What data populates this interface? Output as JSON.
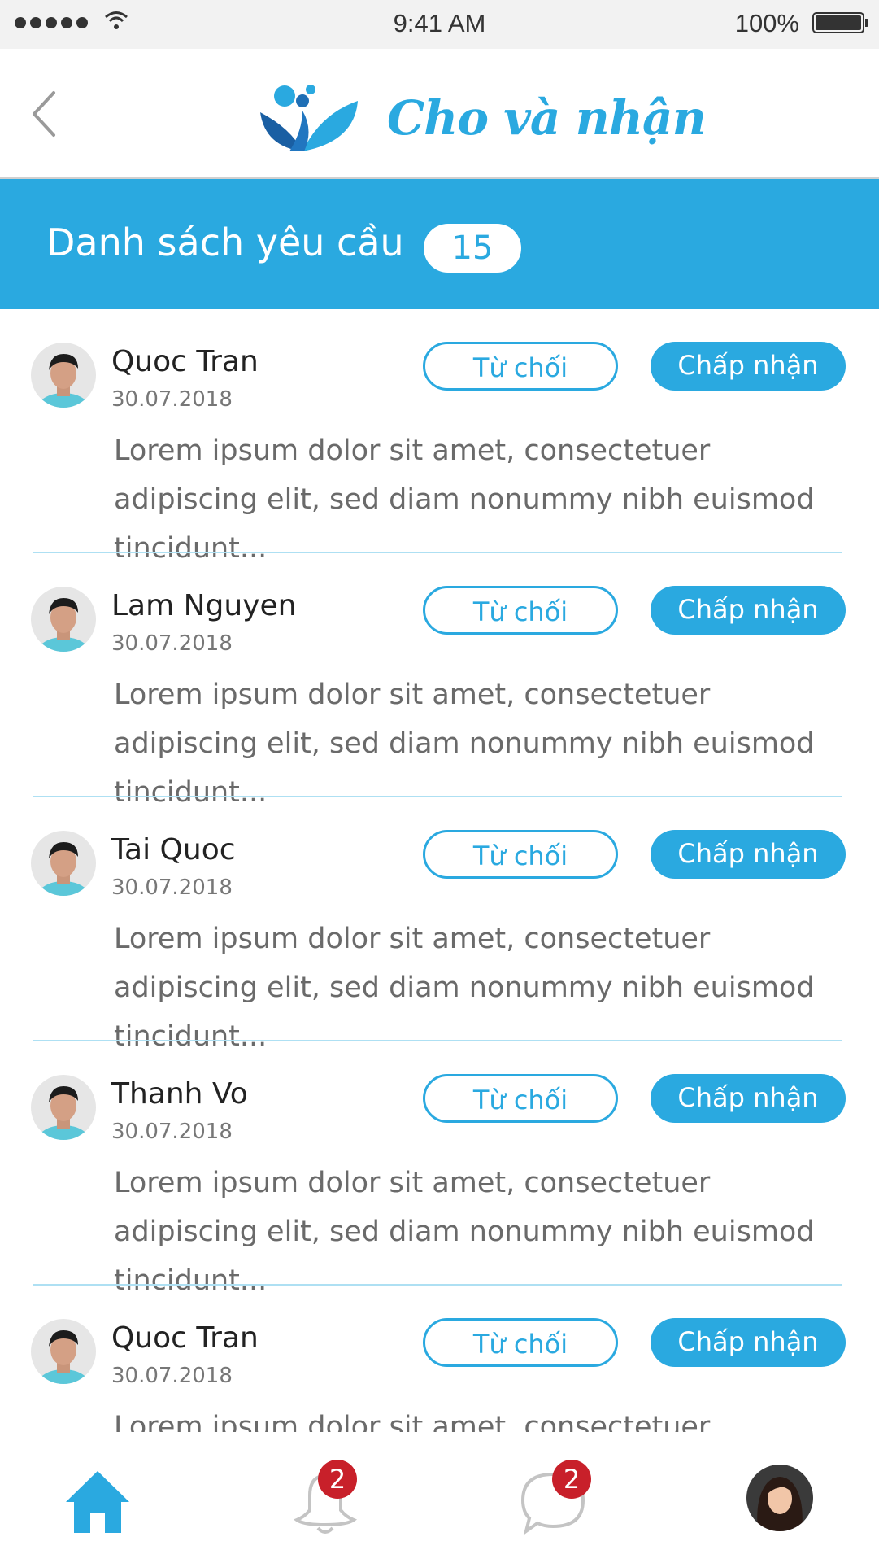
{
  "status_bar": {
    "time": "9:41 AM",
    "battery": "100%"
  },
  "nav": {
    "app_name": "Cho và nhận",
    "back_icon": "chevron-left-icon",
    "logo_icon": "leaf-logo-icon"
  },
  "header": {
    "title": "Danh sách yêu cầu",
    "count": "15"
  },
  "buttons": {
    "reject": "Từ chối",
    "accept": "Chấp nhận"
  },
  "requests": [
    {
      "name": "Quoc Tran",
      "date": "30.07.2018",
      "message": "Lorem ipsum dolor sit amet, consectetuer adipiscing elit, sed diam nonummy nibh euismod tincidunt..."
    },
    {
      "name": "Lam Nguyen",
      "date": "30.07.2018",
      "message": "Lorem ipsum dolor sit amet, consectetuer adipiscing elit, sed diam nonummy nibh euismod tincidunt..."
    },
    {
      "name": "Tai Quoc",
      "date": "30.07.2018",
      "message": "Lorem ipsum dolor sit amet, consectetuer adipiscing elit, sed diam nonummy nibh euismod tincidunt..."
    },
    {
      "name": "Thanh Vo",
      "date": "30.07.2018",
      "message": "Lorem ipsum dolor sit amet, consectetuer adipiscing elit, sed diam nonummy nibh euismod tincidunt..."
    },
    {
      "name": "Quoc Tran",
      "date": "30.07.2018",
      "message": "Lorem ipsum dolor sit amet, consectetuer adipiscing elit, sed diam nonummy nibh euismod tincidunt..."
    }
  ],
  "tab_bar": {
    "home_icon": "home-icon",
    "notifications_icon": "bell-icon",
    "notifications_badge": "2",
    "messages_icon": "chat-bubble-icon",
    "messages_badge": "2",
    "profile_icon": "avatar"
  },
  "colors": {
    "primary": "#2aa9e0",
    "badge": "#c8202a",
    "divider": "#aee0f3"
  }
}
